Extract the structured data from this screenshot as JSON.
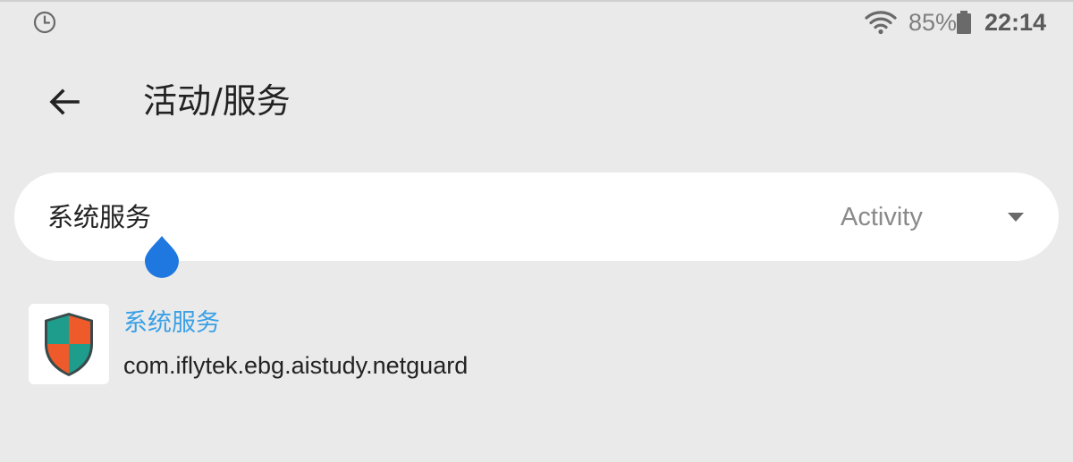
{
  "status_bar": {
    "battery_percent": "85%",
    "time": "22:14",
    "icons": [
      "clock-icon",
      "wifi-icon",
      "battery-icon"
    ]
  },
  "toolbar": {
    "title": "活动/服务",
    "back_icon": "arrow-left-icon"
  },
  "search": {
    "value": "系统服务",
    "type_selected": "Activity"
  },
  "results": [
    {
      "name": "系统服务",
      "package": "com.iflytek.ebg.aistudy.netguard",
      "icon": "shield-icon"
    }
  ],
  "colors": {
    "background": "#eaeaea",
    "accent_link": "#3aa0e6",
    "handle": "#1e78e0"
  }
}
